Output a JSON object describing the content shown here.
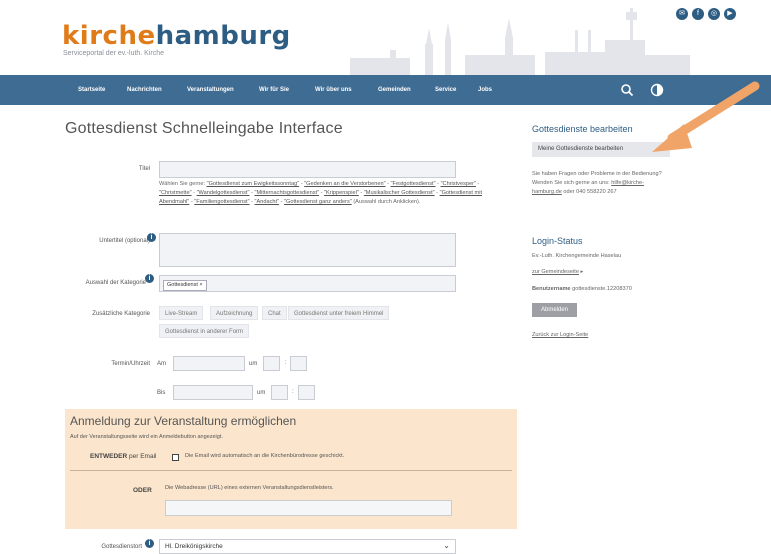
{
  "header": {
    "logo_part1": "kirche",
    "logo_part2": "hamburg",
    "tagline": "Serviceportal der ev.-luth. Kirche"
  },
  "social_icons": [
    "social-icon-1",
    "social-icon-2",
    "social-icon-3",
    "social-icon-4"
  ],
  "nav": {
    "items": [
      "Startseite",
      "Nachrichten",
      "Veranstaltungen",
      "Wir für Sie",
      "Wir über uns",
      "Gemeinden",
      "Service",
      "Jobs"
    ],
    "search_icon": "search-icon",
    "contrast_icon": "contrast-icon"
  },
  "page_title": "Gottesdienst Schnelleingabe Interface",
  "form": {
    "titel_label": "Titel",
    "titel_value": "",
    "titel_hint": {
      "intro": "Wählen Sie gerne: ",
      "options": [
        "\"Gottesdienst zum Ewigkeitssonntag\"",
        "\"Gedenken an die Verstorbenen\"",
        "\"Festgottesdienst\"",
        "\"Christvesper\"",
        "\"Christmette\"",
        "\"Wandelgottesdienst\"",
        "\"Mitternachtsgottesdienst\"",
        "\"Krippenspiel\"",
        "\"Musikalischer Gottesdienst\"",
        "\"Gottesdienst mit Abendmahl\"",
        "\"Familiengottesdienst\"",
        "\"Andacht\"",
        "\"Gottesdienst ganz anders\""
      ],
      "outro": "(Auswahl durch Anklicken)."
    },
    "untertitel_label": "Untertitel (optional)",
    "untertitel_value": "",
    "kategorie_label": "Auswahl der Kategorie",
    "kategorie_tag": "Gottesdienst ×",
    "zusatz_label": "Zusätzliche Kategorie",
    "zusatz_chips": [
      "Live-Stream",
      "Aufzeichnung",
      "Chat",
      "Gottesdienst unter freiem Himmel",
      "Gottesdienst in anderer Form"
    ],
    "termin_label": "Termin/Uhrzeit",
    "am_label": "Am",
    "um_label": "um",
    "bis_label": "Bis",
    "colon": ":"
  },
  "registration": {
    "title": "Anmeldung zur Veranstaltung ermöglichen",
    "desc": "Auf der Veranstaltungsseite wird ein Anmeldebutton angezeigt.",
    "entweder_label": "ENTWEDER",
    "entweder_suffix": " per Email",
    "email_text": "Die Email wird automatisch an die Kirchenbürodresse geschickt.",
    "oder_label": "ODER",
    "url_hint": "Die Webadresse (URL) eines externen Veranstaltungsdienstleisters."
  },
  "gottesdienstort": {
    "label": "Gottesdienstort",
    "value": "Hl. Dreikönigskirche"
  },
  "sidebar": {
    "bearbeiten_title": "Gottesdienste bearbeiten",
    "bearbeiten_button": "Meine Gottesdienste bearbeiten",
    "help_text": "Sie haben Fragen oder Probleme in der Bedienung? Wenden Sie sich gerne an uns: ",
    "help_email": "hilfe@kirche-hamburg.de",
    "help_phone_prefix": " oder 040 558220 267",
    "login_title": "Login-Status",
    "login_org": "Ev.-Luth. Kirchengemeinde Haselau",
    "gemeindeseite_link": "zur Gemeindeseite",
    "gemeindeseite_arrow": "▸",
    "benutzer_label": "Benutzername",
    "benutzer_value": " gottesdienste.12208370",
    "abmelden": "Abmelden",
    "login_back": "Zurück zur Login-Seite"
  },
  "colors": {
    "brand_blue": "#3f6c93",
    "brand_orange": "#e07b1a",
    "highlight_box": "#fbe5cc",
    "arrow": "#f0a468"
  }
}
